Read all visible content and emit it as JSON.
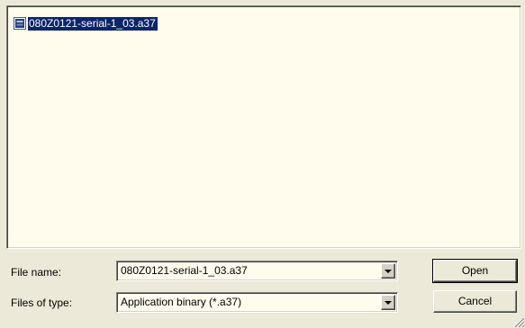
{
  "file_list": {
    "items": [
      {
        "name": "080Z0121-serial-1_03.a37",
        "icon": "binary-file-icon",
        "selected": true
      }
    ]
  },
  "file_name": {
    "label": "File name:",
    "value": "080Z0121-serial-1_03.a37"
  },
  "file_type": {
    "label": "Files of type:",
    "value": "Application binary (*.a37)"
  },
  "buttons": {
    "open": "Open",
    "cancel": "Cancel"
  },
  "colors": {
    "dialog_bg": "#ECE9D8",
    "list_bg": "#FFFCEE",
    "selection": "#0A246A"
  }
}
